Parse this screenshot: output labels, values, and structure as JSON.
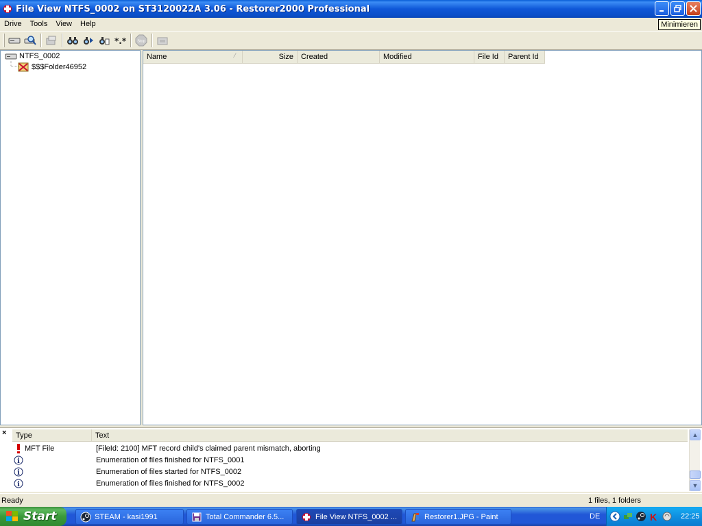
{
  "window": {
    "title": "File View NTFS_0002 on ST3120022A 3.06 - Restorer2000 Professional",
    "tooltip": "Minimieren"
  },
  "menu": [
    "Drive",
    "Tools",
    "View",
    "Help"
  ],
  "toolbar": {
    "buttons": [
      "drive-icon",
      "scan-icon",
      "restore-icon",
      "find-icon",
      "find-next-icon",
      "find-file-icon",
      "mask-icon",
      "stop-icon",
      "folder-icon"
    ],
    "stop_label": "Stop"
  },
  "tree": {
    "root": "NTFS_0002",
    "child": "$$$Folder46952"
  },
  "file_list": {
    "columns": [
      "Name",
      "Size",
      "Created",
      "Modified",
      "File Id",
      "Parent Id"
    ],
    "rows": []
  },
  "log": {
    "columns": [
      "Type",
      "Text"
    ],
    "rows": [
      {
        "icon": "error-icon",
        "type": "MFT File",
        "text": "[FileId: 2100] MFT record child's claimed parent mismatch, aborting"
      },
      {
        "icon": "info-icon",
        "type": "",
        "text": "Enumeration of files finished for NTFS_0001"
      },
      {
        "icon": "info-icon",
        "type": "",
        "text": "Enumeration of files started for NTFS_0002"
      },
      {
        "icon": "info-icon",
        "type": "",
        "text": "Enumeration of files finished for NTFS_0002"
      }
    ]
  },
  "status": {
    "left": "Ready",
    "right": "1 files, 1 folders"
  },
  "taskbar": {
    "start": "Start",
    "tasks": [
      {
        "label": "STEAM - kasi1991",
        "icon": "steam-icon"
      },
      {
        "label": "Total Commander 6.5...",
        "icon": "floppy-icon"
      },
      {
        "label": "File View NTFS_0002 ...",
        "icon": "restorer-icon"
      },
      {
        "label": "Restorer1.JPG - Paint",
        "icon": "paint-icon"
      }
    ],
    "language": "DE",
    "clock": "22:25"
  }
}
